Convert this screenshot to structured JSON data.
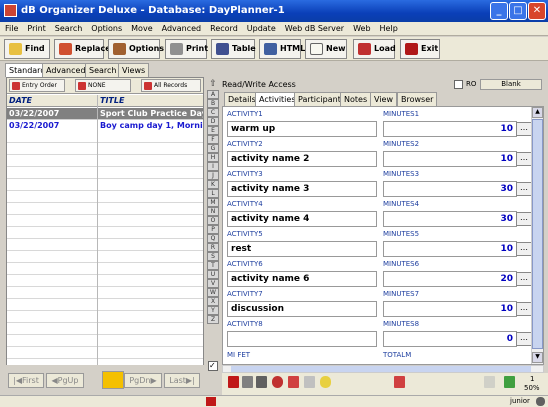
{
  "window": {
    "title": "dB Organizer Deluxe - Database: DayPlanner-1"
  },
  "menu": [
    "File",
    "Print",
    "Search",
    "Options",
    "Move",
    "Advanced",
    "Record",
    "Update",
    "Web dB Server",
    "Web",
    "Help"
  ],
  "toolbar": {
    "find": "Find",
    "replace": "Replace",
    "options": "Options",
    "print": "Print",
    "table": "Table",
    "html": "HTML",
    "new": "New",
    "load": "Load",
    "exit": "Exit"
  },
  "left_tabs": [
    "Standard",
    "Advanced",
    "Search",
    "Views"
  ],
  "sort_buttons": [
    "Entry Order",
    "NONE",
    "All Records"
  ],
  "list": {
    "columns": [
      "DATE",
      "TITLE"
    ],
    "rows": [
      {
        "date": "03/22/2007",
        "title": "Sport Club Practice Day"
      },
      {
        "date": "03/22/2007",
        "title": "Boy camp day 1, Morning"
      }
    ]
  },
  "nav": {
    "first": "First",
    "pgup": "PgUp",
    "pgdn": "PgDn",
    "last": "Last"
  },
  "alpha": [
    "A",
    "B",
    "C",
    "D",
    "E",
    "F",
    "G",
    "H",
    "I",
    "J",
    "K",
    "L",
    "M",
    "N",
    "O",
    "P",
    "Q",
    "R",
    "S",
    "T",
    "U",
    "V",
    "W",
    "X",
    "Y",
    "Z"
  ],
  "right": {
    "access": "Read/Write Access",
    "ro_label": "RO",
    "blank_button": "Blank",
    "tabs": [
      "Details",
      "Activities",
      "Participants",
      "Notes",
      "View",
      "Browser"
    ]
  },
  "activities": [
    {
      "label": "ACTIVITY1",
      "value": "warm up",
      "min_label": "MINUTES1",
      "minutes": "10"
    },
    {
      "label": "ACTIVITY2",
      "value": "activity name 2",
      "min_label": "MINUTES2",
      "minutes": "10"
    },
    {
      "label": "ACTIVITY3",
      "value": "activity name 3",
      "min_label": "MINUTES3",
      "minutes": "30"
    },
    {
      "label": "ACTIVITY4",
      "value": "activity name 4",
      "min_label": "MINUTES4",
      "minutes": "30"
    },
    {
      "label": "ACTIVITY5",
      "value": "rest",
      "min_label": "MINUTES5",
      "minutes": "10"
    },
    {
      "label": "ACTIVITY6",
      "value": "activity name 6",
      "min_label": "MINUTES6",
      "minutes": "20"
    },
    {
      "label": "ACTIVITY7",
      "value": "discussion",
      "min_label": "MINUTES7",
      "minutes": "10"
    },
    {
      "label": "ACTIVITY8",
      "value": "",
      "min_label": "MINUTES8",
      "minutes": "0"
    }
  ],
  "bottom_labels": {
    "left": "MI FET",
    "right": "TOTALM"
  },
  "zoom": {
    "page": "1",
    "percent": "50%"
  },
  "status": {
    "user": "junior"
  }
}
